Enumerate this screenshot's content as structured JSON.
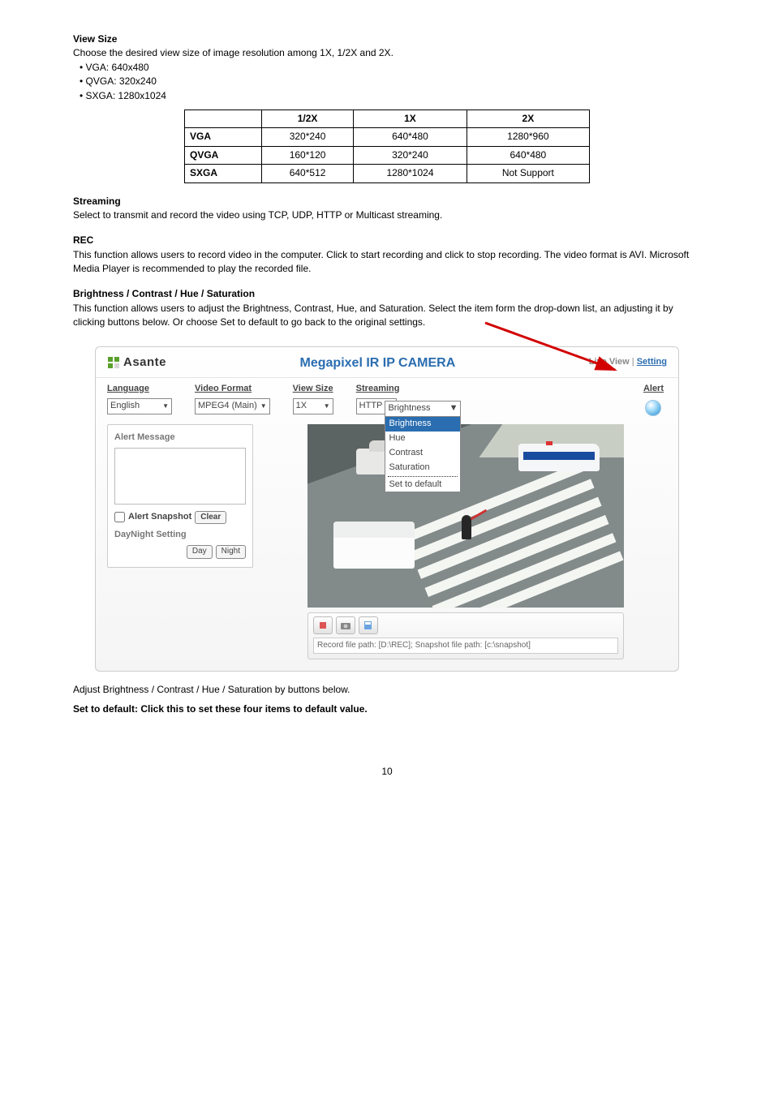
{
  "section1": {
    "heading": "View Size",
    "body": "Choose the desired view size of image resolution among 1X, 1/2X and 2X.",
    "bullets": [
      "VGA: 640x480",
      "QVGA: 320x240",
      "SXGA: 1280x1024"
    ],
    "table": {
      "header": [
        "",
        "1/2X",
        "1X",
        "2X"
      ],
      "rows": [
        [
          "VGA",
          "320*240",
          "640*480",
          "1280*960"
        ],
        [
          "QVGA",
          "160*120",
          "320*240",
          "640*480"
        ],
        [
          "SXGA",
          "640*512",
          "1280*1024",
          "Not Support"
        ]
      ]
    }
  },
  "section2": {
    "heading": "Streaming",
    "body": "Select to transmit and record the video using TCP, UDP, HTTP or Multicast streaming."
  },
  "section3": {
    "heading": "REC",
    "body": "This function allows users to record video in the computer. Click to start recording and click to stop recording. The video format is AVI. Microsoft Media Player is recommended to play the recorded file."
  },
  "section4": {
    "heading": "Brightness / Contrast / Hue / Saturation",
    "body": "This function allows users to adjust the Brightness, Contrast, Hue, and Saturation. Select the item form the drop-down list, an adjusting it by clicking buttons below. Or choose Set to default to go back to the original settings."
  },
  "camera": {
    "logo_text": "Asante",
    "title": "Megapixel IR IP CAMERA",
    "nav": {
      "live": "Live View",
      "sep": " | ",
      "setting": "Setting"
    },
    "toolbar": {
      "language": {
        "label": "Language",
        "value": "English"
      },
      "video_format": {
        "label": "Video Format",
        "value": "MPEG4 (Main)"
      },
      "view_size": {
        "label": "View Size",
        "value": "1X"
      },
      "streaming": {
        "label": "Streaming",
        "value": "HTTP"
      },
      "image_adj": {
        "value": "Brightness",
        "options": [
          "Brightness",
          "Hue",
          "Contrast",
          "Saturation"
        ],
        "footer": "Set to default"
      },
      "alert": {
        "label": "Alert"
      }
    },
    "side": {
      "alert_msg_label": "Alert Message",
      "alert_snapshot_label": "Alert Snapshot",
      "clear": "Clear",
      "daynight_label": "DayNight Setting",
      "day": "Day",
      "night": "Night"
    },
    "rec_path": "Record file path: [D:\\REC]; Snapshot file path: [c:\\snapshot]"
  },
  "after1": "Adjust Brightness / Contrast / Hue / Saturation by buttons below.",
  "after2": "Set to default: Click this to set these four items to default value.",
  "page_number": "10"
}
